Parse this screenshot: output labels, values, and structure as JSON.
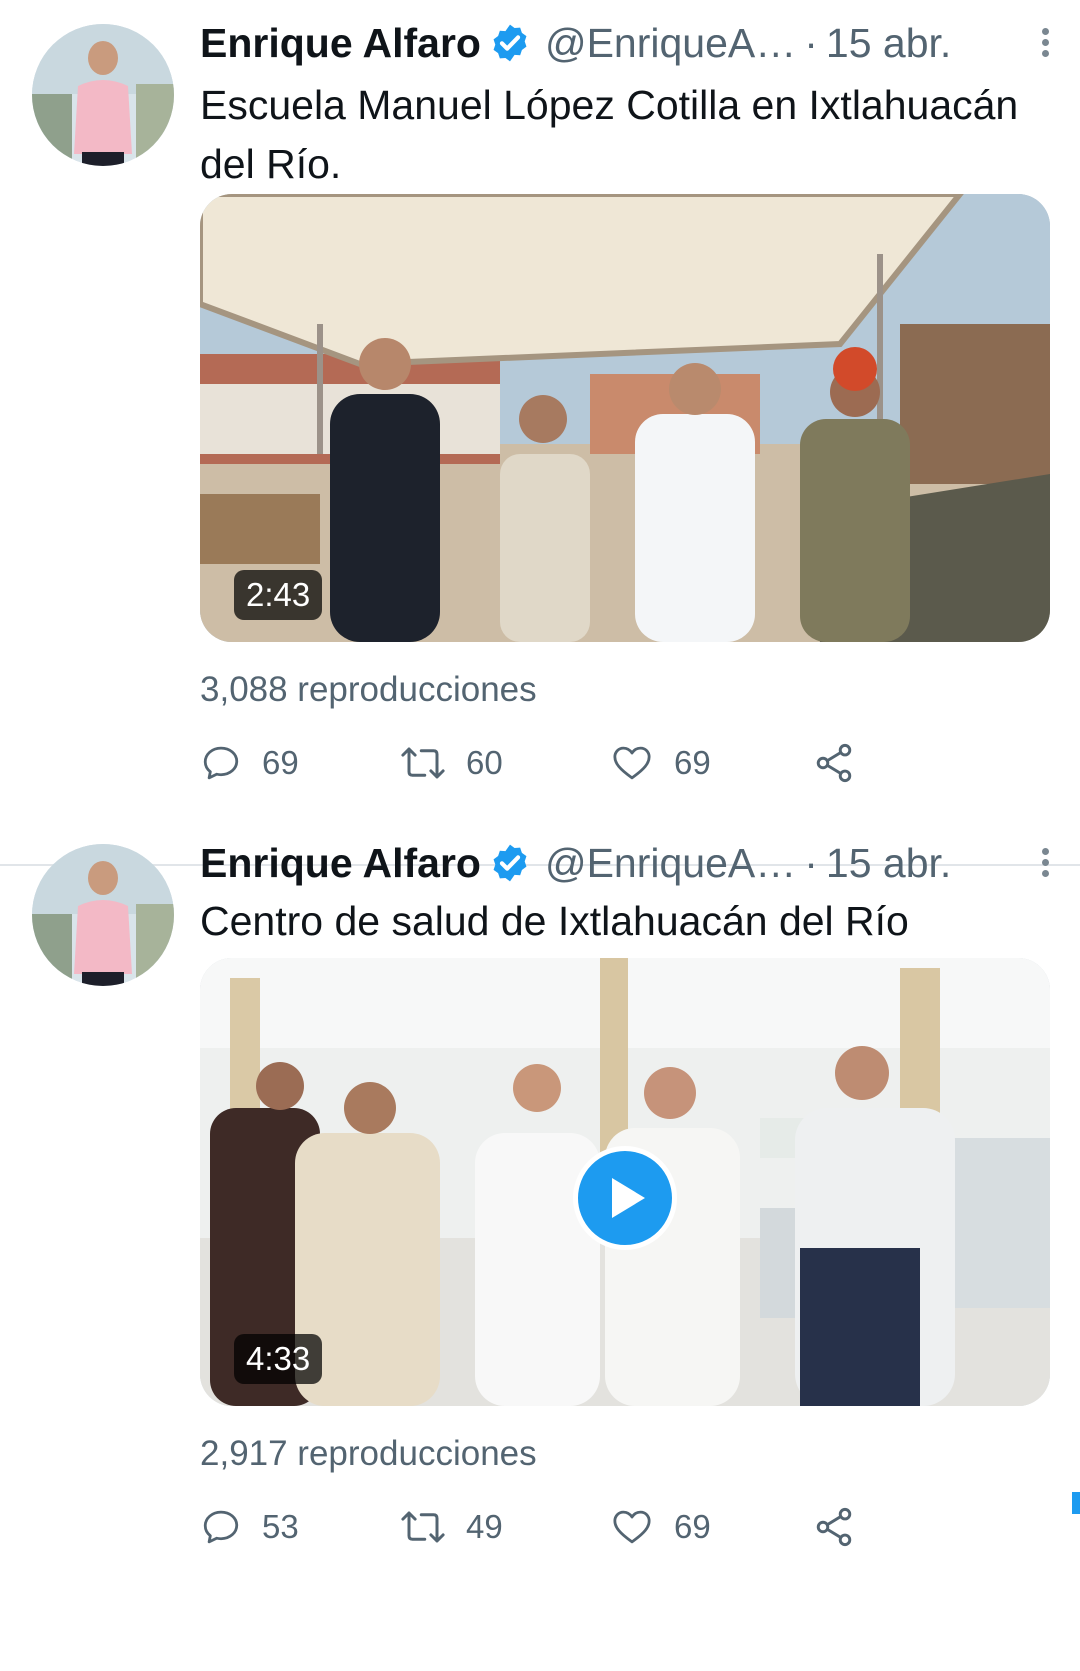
{
  "colors": {
    "accent": "#1d9bf0",
    "secondary_text": "#536471",
    "divider": "#e1e5e9"
  },
  "tweets": [
    {
      "author": {
        "name": "Enrique Alfaro",
        "handle": "@EnriqueA…",
        "verified": true,
        "avatar": "avatar-photo"
      },
      "separator": "·",
      "date": "15 abr.",
      "text": "Escuela Manuel López Cotilla en Ixtlahuacán del Río.",
      "media": {
        "type": "video",
        "duration": "2:43",
        "scene": "four men wearing face masks standing under a school shade canopy",
        "play_button_visible": false
      },
      "views": "3,088 reproducciones",
      "actions": {
        "replies": "69",
        "retweets": "60",
        "likes": "69"
      }
    },
    {
      "author": {
        "name": "Enrique Alfaro",
        "handle": "@EnriqueA…",
        "verified": true,
        "avatar": "avatar-photo"
      },
      "separator": "·",
      "date": "15 abr.",
      "text": "Centro de salud de Ixtlahuacán del Río",
      "media": {
        "type": "video",
        "duration": "4:33",
        "scene": "five people wearing face masks standing in a health center ward with beds",
        "play_button_visible": true
      },
      "views": "2,917 reproducciones",
      "actions": {
        "replies": "53",
        "retweets": "49",
        "likes": "69"
      }
    }
  ],
  "icons": {
    "verified": "verified-badge-icon",
    "more": "more-vertical-icon",
    "reply": "reply-icon",
    "retweet": "retweet-icon",
    "like": "heart-icon",
    "share": "share-icon",
    "play": "play-icon"
  }
}
